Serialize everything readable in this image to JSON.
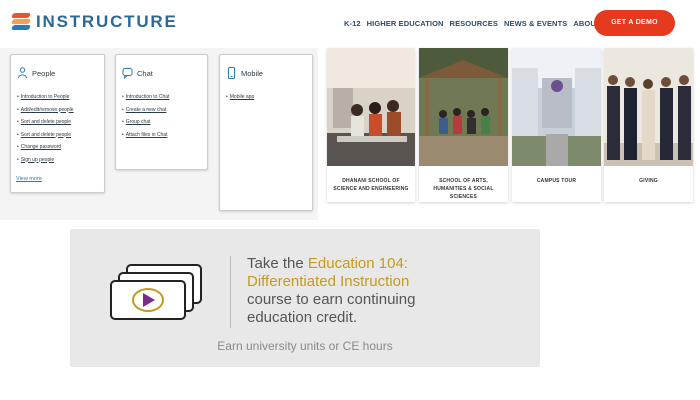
{
  "header": {
    "logo_text": "INSTRUCTURE",
    "nav": [
      "K-12",
      "HIGHER EDUCATION",
      "RESOURCES",
      "NEWS & EVENTS",
      "ABOUT US"
    ],
    "cta_label": "GET A DEMO"
  },
  "cards": [
    {
      "title": "People",
      "icon": "person-icon",
      "links": [
        "Introduction to People",
        "Add/edit/remove people",
        "Sort and delete people",
        "Sort and delete people",
        "Change password",
        "Sign up people"
      ],
      "view_more": "View more"
    },
    {
      "title": "Chat",
      "icon": "chat-icon",
      "links": [
        "Introduction to Chat",
        "Create a new chat",
        "Group chat",
        "Attach files in Chat"
      ]
    },
    {
      "title": "Mobile",
      "icon": "mobile-icon",
      "links": [
        "Mobile app"
      ]
    }
  ],
  "tiles": [
    {
      "caption": "DHANANI SCHOOL OF SCIENCE AND ENGINEERING"
    },
    {
      "caption": "SCHOOL OF ARTS, HUMANITIES & SOCIAL SCIENCES"
    },
    {
      "caption": "CAMPUS TOUR"
    },
    {
      "caption": "GIVING"
    }
  ],
  "promo": {
    "line1_pre": "Take the ",
    "line1_hl": "Education 104:",
    "line2_hl": "Differentiated Instruction",
    "line3": "course to earn continuing",
    "line4": "education credit.",
    "sub": "Earn university units or CE hours"
  },
  "colors": {
    "brand_blue": "#2b6a95",
    "cta": "#e63a1f",
    "highlight": "#c49a1e",
    "play": "#7b2d8e"
  }
}
